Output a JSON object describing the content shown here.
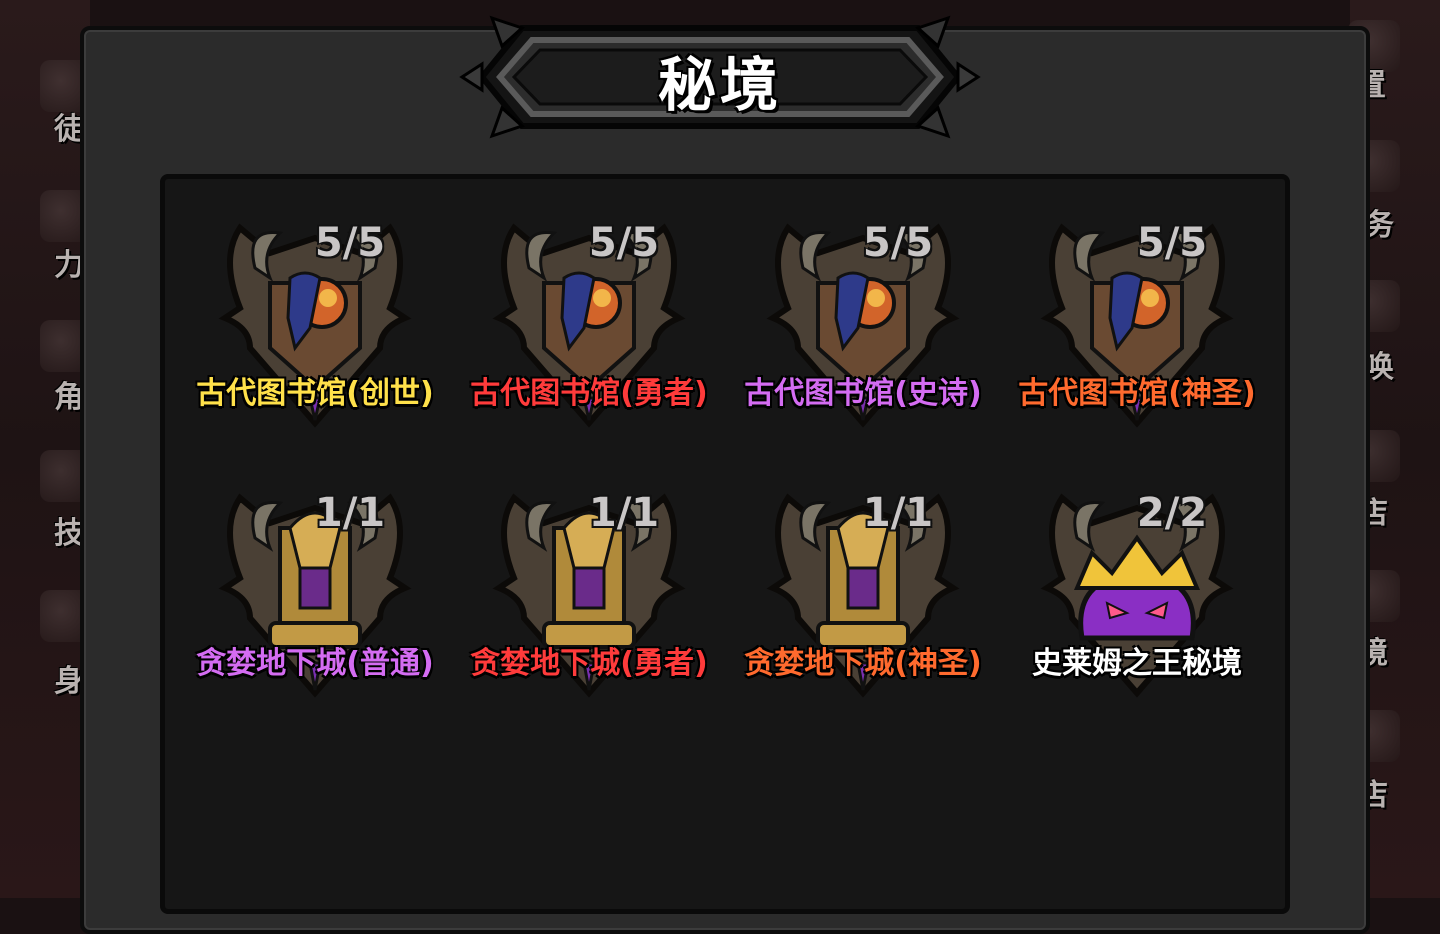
{
  "window": {
    "title": "秘境"
  },
  "side_left": {
    "labels": [
      "徒",
      "力",
      "角",
      "技",
      "身"
    ]
  },
  "side_right": {
    "labels": [
      "置",
      "务",
      "唤",
      "店",
      "境",
      "店"
    ]
  },
  "grid": {
    "rows": [
      [
        {
          "name": "古代图书馆(创世)",
          "count": "5/5",
          "color": "#ffe14a",
          "icon": "library-boss-icon"
        },
        {
          "name": "古代图书馆(勇者)",
          "count": "5/5",
          "color": "#ff3b3b",
          "icon": "library-boss-icon"
        },
        {
          "name": "古代图书馆(史诗)",
          "count": "5/5",
          "color": "#d46cf2",
          "icon": "library-boss-icon"
        },
        {
          "name": "古代图书馆(神圣)",
          "count": "5/5",
          "color": "#ff6a2e",
          "icon": "library-boss-icon"
        }
      ],
      [
        {
          "name": "贪婪地下城(普通)",
          "count": "1/1",
          "color": "#d46cf2",
          "icon": "greed-shrine-icon"
        },
        {
          "name": "贪婪地下城(勇者)",
          "count": "1/1",
          "color": "#ff3b3b",
          "icon": "greed-shrine-icon"
        },
        {
          "name": "贪婪地下城(神圣)",
          "count": "1/1",
          "color": "#ff6a2e",
          "icon": "greed-shrine-icon"
        },
        {
          "name": "史莱姆之王秘境",
          "count": "2/2",
          "color": "#ffffff",
          "icon": "slime-king-icon"
        }
      ]
    ]
  }
}
